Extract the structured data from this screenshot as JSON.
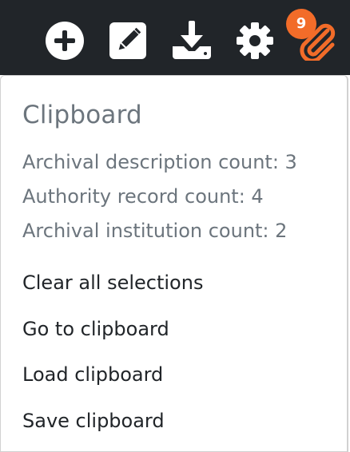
{
  "toolbar": {
    "icons": [
      "add-icon",
      "edit-icon",
      "import-icon",
      "settings-icon",
      "clipboard-icon"
    ],
    "badge_count": "9",
    "accent": "#f26c29",
    "bar_color": "#212529"
  },
  "clipboard_menu": {
    "header": "Clipboard",
    "counts": [
      "Archival description count: 3",
      "Authority record count: 4",
      "Archival institution count: 2"
    ],
    "actions": [
      "Clear all selections",
      "Go to clipboard",
      "Load clipboard",
      "Save clipboard"
    ]
  }
}
